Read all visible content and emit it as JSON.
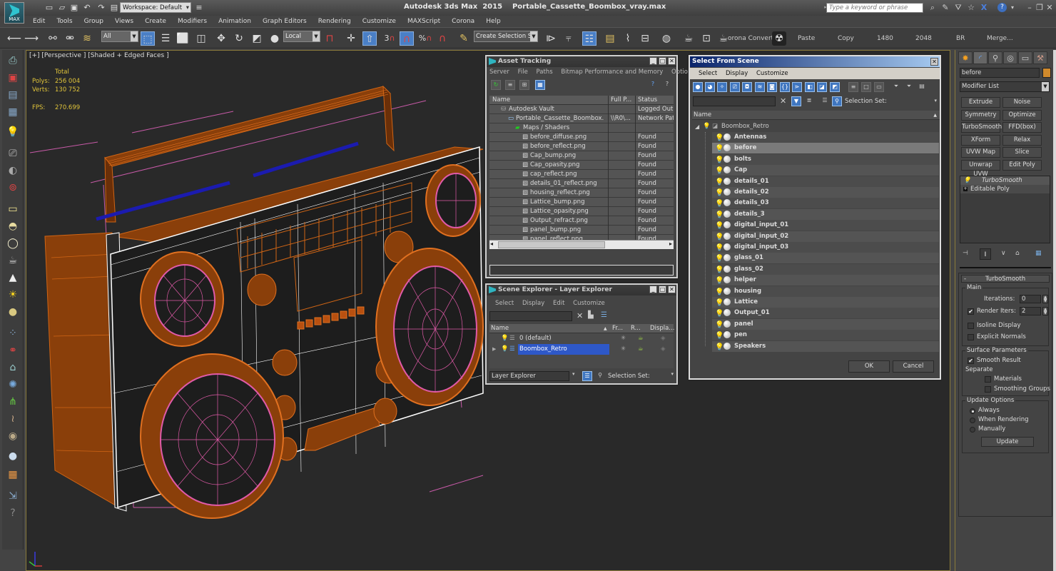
{
  "app": {
    "title": "Autodesk 3ds Max  2015    Portable_Cassette_Boombox_vray.max",
    "max_button_label": "MAX",
    "workspace": "Workspace: Default",
    "search_placeholder": "Type a keyword or phrase"
  },
  "menubar": [
    "Edit",
    "Tools",
    "Group",
    "Views",
    "Create",
    "Modifiers",
    "Animation",
    "Graph Editors",
    "Rendering",
    "Customize",
    "MAXScript",
    "Corona",
    "Help"
  ],
  "toolbar": {
    "selection_filter": "All",
    "ref_coord": "Local",
    "snap_angle_label": "3",
    "percent_snap_label": "%",
    "create_selection_set": "Create Selection Se",
    "corona_convert": "orona Convert",
    "script_buttons": [
      "Paste",
      "Copy",
      "1480",
      "2048",
      "BR",
      "Merge..."
    ]
  },
  "viewport": {
    "label": "[+] [Perspective ] [Shaded + Edged Faces ]",
    "stats": {
      "total_label": "Total",
      "polys_label": "Polys:",
      "polys": "256 004",
      "verts_label": "Verts:",
      "verts": "130 752",
      "fps_label": "FPS:",
      "fps": "270.699"
    },
    "colors": {
      "wire_orange": "#c0580f",
      "wire_white": "#ffffff",
      "speaker_pink": "#e05aa8",
      "antenna_blue": "#1b1bb0",
      "bbox_pink": "#d060b0"
    }
  },
  "asset_tracking": {
    "title": "Asset Tracking",
    "menu": [
      "Server",
      "File",
      "Paths",
      "Bitmap Performance and Memory",
      "Options"
    ],
    "columns": [
      "Name",
      "Full P...",
      "Status"
    ],
    "rows": [
      {
        "name": "Autodesk Vault",
        "path": "",
        "status": "Logged Out (...",
        "indent": 1,
        "icon": "vault"
      },
      {
        "name": "Portable_Cassette_Boombox...",
        "path": "\\\\R0\\...",
        "status": "Network Path",
        "indent": 2,
        "icon": "file"
      },
      {
        "name": "Maps / Shaders",
        "path": "",
        "status": "",
        "indent": 3,
        "icon": "maps"
      },
      {
        "name": "before_diffuse.png",
        "path": "",
        "status": "Found",
        "indent": 4,
        "icon": "bitmap"
      },
      {
        "name": "before_reflect.png",
        "path": "",
        "status": "Found",
        "indent": 4,
        "icon": "bitmap"
      },
      {
        "name": "Cap_bump.png",
        "path": "",
        "status": "Found",
        "indent": 4,
        "icon": "bitmap"
      },
      {
        "name": "Cap_opasity.png",
        "path": "",
        "status": "Found",
        "indent": 4,
        "icon": "bitmap"
      },
      {
        "name": "cap_reflect.png",
        "path": "",
        "status": "Found",
        "indent": 4,
        "icon": "bitmap"
      },
      {
        "name": "details_01_reflect.png",
        "path": "",
        "status": "Found",
        "indent": 4,
        "icon": "bitmap"
      },
      {
        "name": "housing_reflect.png",
        "path": "",
        "status": "Found",
        "indent": 4,
        "icon": "bitmap"
      },
      {
        "name": "Lattice_bump.png",
        "path": "",
        "status": "Found",
        "indent": 4,
        "icon": "bitmap"
      },
      {
        "name": "Lattice_opasity.png",
        "path": "",
        "status": "Found",
        "indent": 4,
        "icon": "bitmap"
      },
      {
        "name": "Output_refract.png",
        "path": "",
        "status": "Found",
        "indent": 4,
        "icon": "bitmap"
      },
      {
        "name": "panel_bump.png",
        "path": "",
        "status": "Found",
        "indent": 4,
        "icon": "bitmap"
      },
      {
        "name": "panel_reflect.png",
        "path": "",
        "status": "Found",
        "indent": 4,
        "icon": "bitmap"
      }
    ]
  },
  "layer_explorer": {
    "title": "Scene Explorer - Layer Explorer",
    "menu": [
      "Select",
      "Display",
      "Edit",
      "Customize"
    ],
    "columns": [
      "Name",
      "Fr...",
      "R...",
      "Displa..."
    ],
    "rows": [
      {
        "name": "0 (default)",
        "selected": false
      },
      {
        "name": "Boombox_Retro",
        "selected": true
      }
    ],
    "explorer_select": "Layer Explorer",
    "selection_set_label": "Selection Set:"
  },
  "select_from_scene": {
    "title": "Select From Scene",
    "menu": [
      "Select",
      "Display",
      "Customize"
    ],
    "selection_set_label": "Selection Set:",
    "column": "Name",
    "root": "Boombox_Retro",
    "objects": [
      "Antennas",
      "before",
      "bolts",
      "Cap",
      "details_01",
      "details_02",
      "details_03",
      "details_3",
      "digital_input_01",
      "digital_input_02",
      "digital_input_03",
      "glass_01",
      "glass_02",
      "helper",
      "housing",
      "Lattice",
      "Output_01",
      "panel",
      "pen",
      "Speakers"
    ],
    "selected_object": "before",
    "ok": "OK",
    "cancel": "Cancel"
  },
  "command_panel": {
    "object_name": "before",
    "object_color": "#d08a2c",
    "modifier_list": "Modifier List",
    "modifier_buttons": [
      "Extrude",
      "Noise",
      "Symmetry",
      "Optimize",
      "TurboSmooth",
      "FFD(box)",
      "XForm",
      "Relax",
      "UVW Map",
      "Slice",
      "Unwrap UVW",
      "Edit Poly"
    ],
    "stack": [
      "TurboSmooth",
      "Editable Poly"
    ],
    "rollout_title": "TurboSmooth",
    "main_group": "Main",
    "iterations_label": "Iterations:",
    "iterations": "0",
    "render_iters_label": "Render Iters:",
    "render_iters": "2",
    "render_iters_checked": true,
    "isoline_label": "Isoline Display",
    "isoline_checked": false,
    "explicit_normals_label": "Explicit Normals",
    "explicit_normals_checked": false,
    "surface_group": "Surface Parameters",
    "smooth_result_label": "Smooth Result",
    "smooth_result_checked": true,
    "separate_label": "Separate",
    "materials_label": "Materials",
    "smoothing_groups_label": "Smoothing Groups",
    "update_group": "Update Options",
    "update_options": [
      "Always",
      "When Rendering",
      "Manually"
    ],
    "update_selected": "Always",
    "update_button": "Update"
  }
}
